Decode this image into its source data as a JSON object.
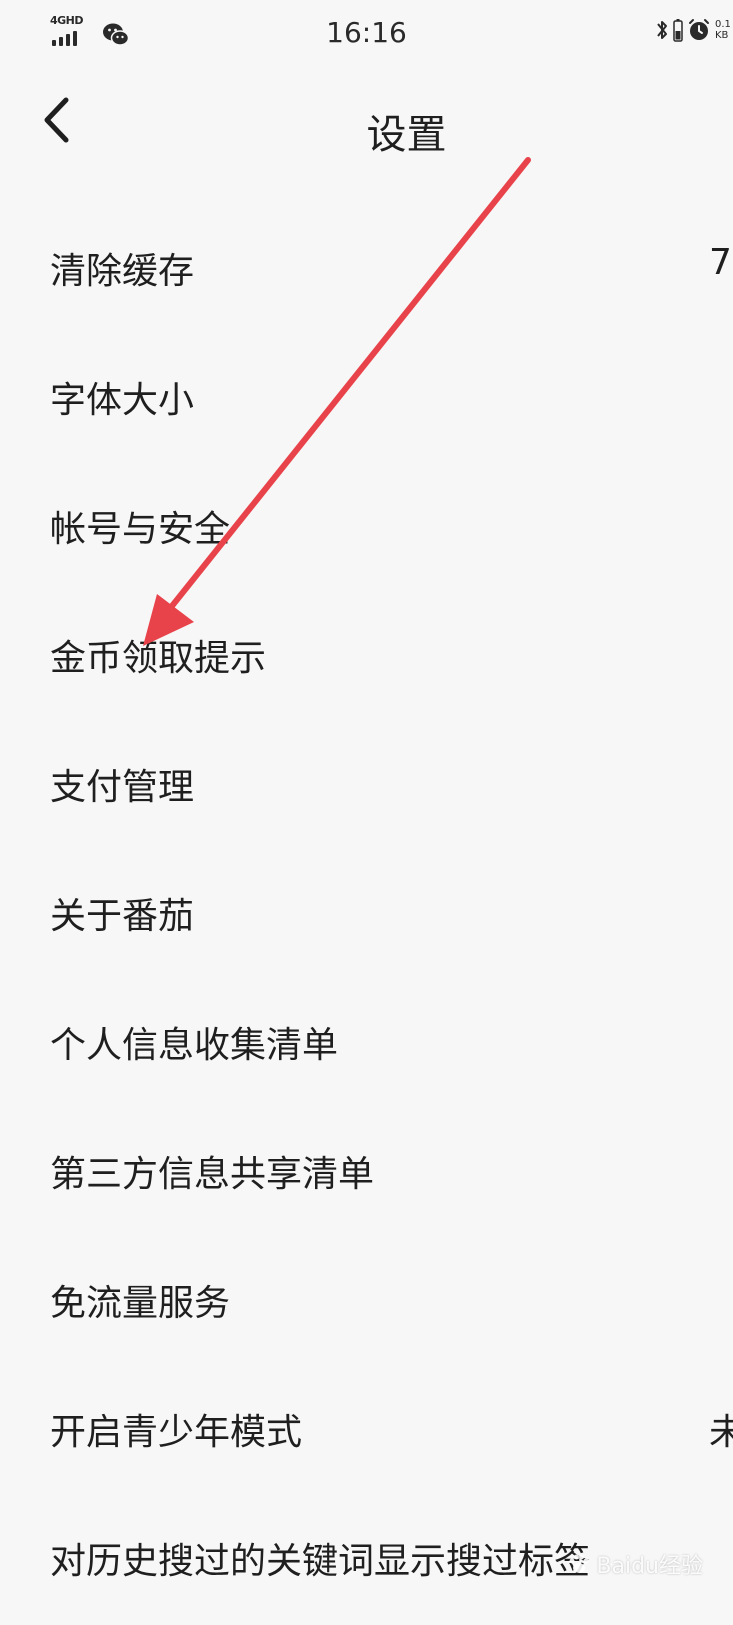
{
  "status_bar": {
    "network": "4GHD",
    "time": "16:16",
    "speed_value": "0.1",
    "speed_unit": "KB",
    "icons": [
      "signal-icon",
      "wechat-icon",
      "bluetooth-icon",
      "battery-icon",
      "alarm-icon"
    ]
  },
  "header": {
    "title": "设置",
    "back_icon": "chevron-left-icon"
  },
  "settings": [
    {
      "label": "清除缓存",
      "value": "7"
    },
    {
      "label": "字体大小",
      "value": ""
    },
    {
      "label": "帐号与安全",
      "value": ""
    },
    {
      "label": "金币领取提示",
      "value": ""
    },
    {
      "label": "支付管理",
      "value": ""
    },
    {
      "label": "关于番茄",
      "value": ""
    },
    {
      "label": "个人信息收集清单",
      "value": ""
    },
    {
      "label": "第三方信息共享清单",
      "value": ""
    },
    {
      "label": "免流量服务",
      "value": ""
    },
    {
      "label": "开启青少年模式",
      "value": "未"
    },
    {
      "label": "对历史搜过的关键词显示搜过标签",
      "value": ""
    }
  ],
  "annotation": {
    "type": "arrow",
    "color": "#e8434a",
    "points_to": "金币领取提示"
  },
  "watermark": {
    "text": "Baidu经验"
  },
  "colors": {
    "background": "#f7f7f7",
    "text": "#1f1f1f",
    "arrow": "#e8434a"
  }
}
